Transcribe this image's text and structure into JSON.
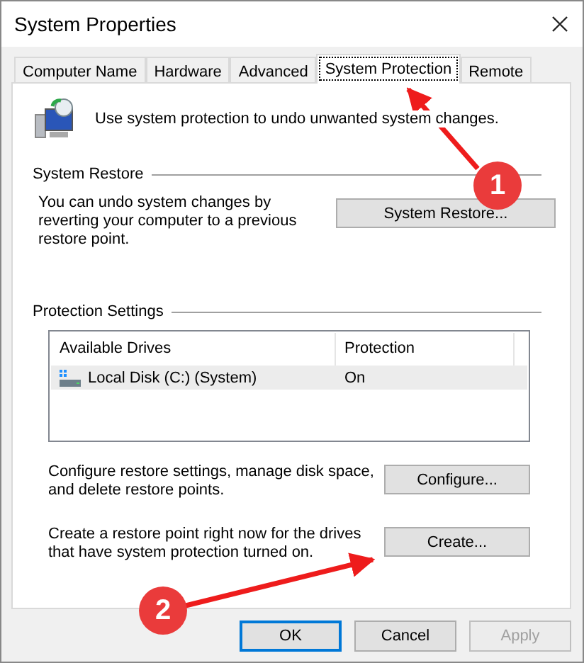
{
  "window": {
    "title": "System Properties"
  },
  "tabs": [
    {
      "label": "Computer Name",
      "selected": false
    },
    {
      "label": "Hardware",
      "selected": false
    },
    {
      "label": "Advanced",
      "selected": false
    },
    {
      "label": "System Protection",
      "selected": true
    },
    {
      "label": "Remote",
      "selected": false
    }
  ],
  "intro": "Use system protection to undo unwanted system changes.",
  "system_restore": {
    "heading": "System Restore",
    "description": "You can undo system changes by reverting your computer to a previous restore point.",
    "button": "System Restore..."
  },
  "protection_settings": {
    "heading": "Protection Settings",
    "columns": [
      "Available Drives",
      "Protection"
    ],
    "rows": [
      {
        "drive": "Local Disk (C:) (System)",
        "protection": "On",
        "selected": true
      }
    ]
  },
  "configure": {
    "description": "Configure restore settings, manage disk space, and delete restore points.",
    "button": "Configure..."
  },
  "create": {
    "description": "Create a restore point right now for the drives that have system protection turned on.",
    "button": "Create..."
  },
  "buttons": [
    {
      "label": "OK",
      "kind": "default",
      "disabled": false
    },
    {
      "label": "Cancel",
      "kind": "normal",
      "disabled": false
    },
    {
      "label": "Apply",
      "kind": "normal",
      "disabled": true
    }
  ],
  "annotations": [
    {
      "number": "1"
    },
    {
      "number": "2"
    }
  ]
}
